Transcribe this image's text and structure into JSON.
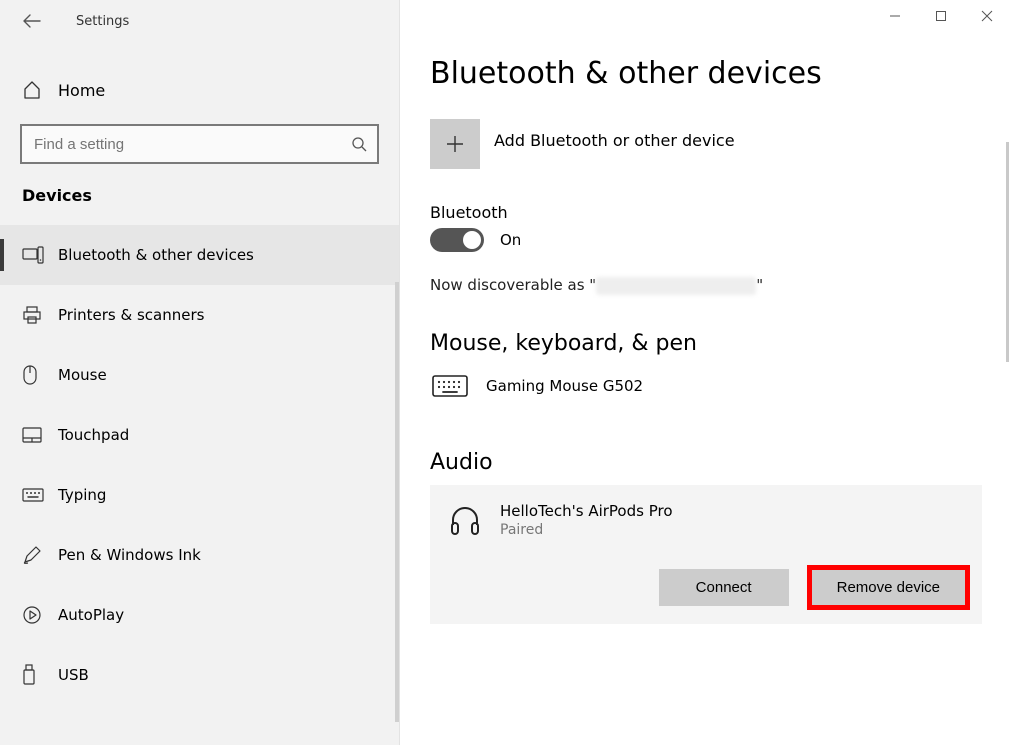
{
  "window": {
    "title": "Settings"
  },
  "sidebar": {
    "home_label": "Home",
    "search_placeholder": "Find a setting",
    "category_header": "Devices",
    "items": [
      {
        "label": "Bluetooth & other devices",
        "selected": true
      },
      {
        "label": "Printers & scanners",
        "selected": false
      },
      {
        "label": "Mouse",
        "selected": false
      },
      {
        "label": "Touchpad",
        "selected": false
      },
      {
        "label": "Typing",
        "selected": false
      },
      {
        "label": "Pen & Windows Ink",
        "selected": false
      },
      {
        "label": "AutoPlay",
        "selected": false
      },
      {
        "label": "USB",
        "selected": false
      }
    ]
  },
  "page": {
    "title": "Bluetooth & other devices",
    "add_device_label": "Add Bluetooth or other device",
    "bluetooth_section_label": "Bluetooth",
    "bluetooth_toggle_state": "On",
    "discoverable_prefix": "Now discoverable as \"",
    "discoverable_suffix": "\"",
    "sections": {
      "mouse_keyboard_pen": {
        "title": "Mouse, keyboard, & pen",
        "devices": [
          {
            "name": "Gaming Mouse G502"
          }
        ]
      },
      "audio": {
        "title": "Audio",
        "devices": [
          {
            "name": "HelloTech's AirPods Pro",
            "status": "Paired",
            "actions": {
              "connect": "Connect",
              "remove": "Remove device"
            }
          }
        ]
      }
    }
  }
}
